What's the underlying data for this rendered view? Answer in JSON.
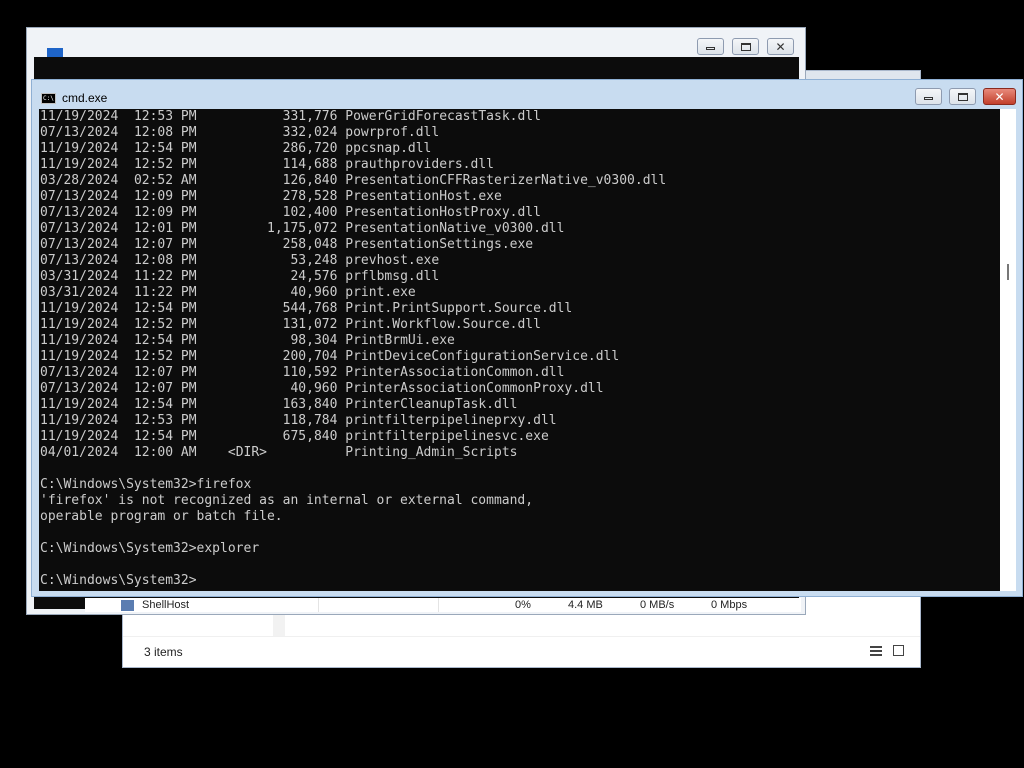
{
  "explorer": {
    "status_count": "3 items",
    "partial_text": "' ' (-)"
  },
  "taskmgr": {
    "process_row": {
      "name": "ShellHost",
      "cpu": "0%",
      "memory": "4.4 MB",
      "disk": "0 MB/s",
      "network": "0 Mbps"
    }
  },
  "cmd": {
    "title": "cmd.exe",
    "icon_text": "C:\\",
    "listing": [
      {
        "date": "11/19/2024",
        "time": "12:53 PM",
        "size": "331,776",
        "name": "PowerGridForecastTask.dll"
      },
      {
        "date": "07/13/2024",
        "time": "12:08 PM",
        "size": "332,024",
        "name": "powrprof.dll"
      },
      {
        "date": "11/19/2024",
        "time": "12:54 PM",
        "size": "286,720",
        "name": "ppcsnap.dll"
      },
      {
        "date": "11/19/2024",
        "time": "12:52 PM",
        "size": "114,688",
        "name": "prauthproviders.dll"
      },
      {
        "date": "03/28/2024",
        "time": "02:52 AM",
        "size": "126,840",
        "name": "PresentationCFFRasterizerNative_v0300.dll"
      },
      {
        "date": "07/13/2024",
        "time": "12:09 PM",
        "size": "278,528",
        "name": "PresentationHost.exe"
      },
      {
        "date": "07/13/2024",
        "time": "12:09 PM",
        "size": "102,400",
        "name": "PresentationHostProxy.dll"
      },
      {
        "date": "07/13/2024",
        "time": "12:01 PM",
        "size": "1,175,072",
        "name": "PresentationNative_v0300.dll"
      },
      {
        "date": "07/13/2024",
        "time": "12:07 PM",
        "size": "258,048",
        "name": "PresentationSettings.exe"
      },
      {
        "date": "07/13/2024",
        "time": "12:08 PM",
        "size": "53,248",
        "name": "prevhost.exe"
      },
      {
        "date": "03/31/2024",
        "time": "11:22 PM",
        "size": "24,576",
        "name": "prflbmsg.dll"
      },
      {
        "date": "03/31/2024",
        "time": "11:22 PM",
        "size": "40,960",
        "name": "print.exe"
      },
      {
        "date": "11/19/2024",
        "time": "12:54 PM",
        "size": "544,768",
        "name": "Print.PrintSupport.Source.dll"
      },
      {
        "date": "11/19/2024",
        "time": "12:52 PM",
        "size": "131,072",
        "name": "Print.Workflow.Source.dll"
      },
      {
        "date": "11/19/2024",
        "time": "12:54 PM",
        "size": "98,304",
        "name": "PrintBrmUi.exe"
      },
      {
        "date": "11/19/2024",
        "time": "12:52 PM",
        "size": "200,704",
        "name": "PrintDeviceConfigurationService.dll"
      },
      {
        "date": "07/13/2024",
        "time": "12:07 PM",
        "size": "110,592",
        "name": "PrinterAssociationCommon.dll"
      },
      {
        "date": "07/13/2024",
        "time": "12:07 PM",
        "size": "40,960",
        "name": "PrinterAssociationCommonProxy.dll"
      },
      {
        "date": "11/19/2024",
        "time": "12:54 PM",
        "size": "163,840",
        "name": "PrinterCleanupTask.dll"
      },
      {
        "date": "11/19/2024",
        "time": "12:53 PM",
        "size": "118,784",
        "name": "printfilterpipelineprxy.dll"
      },
      {
        "date": "11/19/2024",
        "time": "12:54 PM",
        "size": "675,840",
        "name": "printfilterpipelinesvc.exe"
      },
      {
        "date": "04/01/2024",
        "time": "12:00 AM",
        "size": "<DIR>",
        "name": "Printing_Admin_Scripts"
      }
    ],
    "lines_after": [
      "",
      "C:\\Windows\\System32>firefox",
      "'firefox' is not recognized as an internal or external command,",
      "operable program or batch file.",
      "",
      "C:\\Windows\\System32>explorer",
      "",
      "C:\\Windows\\System32>"
    ]
  }
}
